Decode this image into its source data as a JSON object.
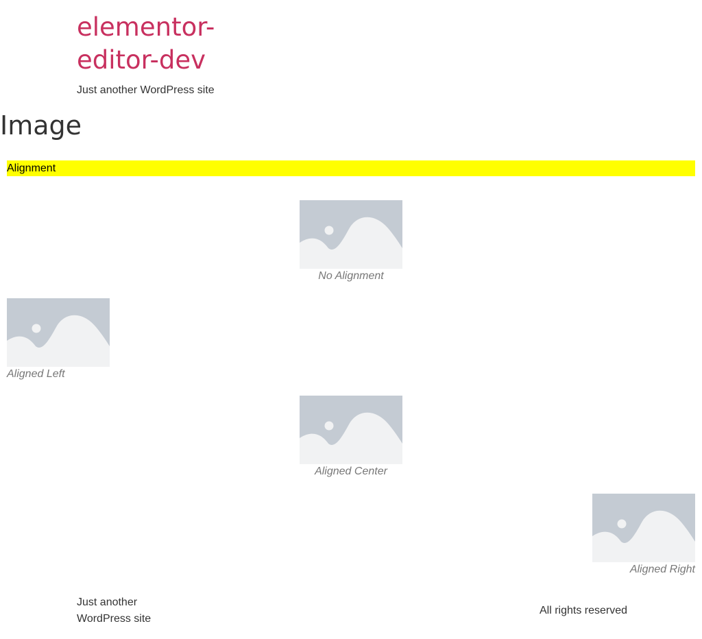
{
  "header": {
    "site_title": "elementor-editor-dev",
    "site_description": "Just another WordPress site"
  },
  "main": {
    "page_title": "Image",
    "section_heading": "Alignment",
    "figures": [
      {
        "caption": "No Alignment",
        "alignment": "none"
      },
      {
        "caption": "Aligned Left",
        "alignment": "left"
      },
      {
        "caption": "Aligned Center",
        "alignment": "center"
      },
      {
        "caption": "Aligned Right",
        "alignment": "right"
      }
    ]
  },
  "footer": {
    "description": "Just another WordPress site",
    "copyright": "All rights reserved"
  },
  "colors": {
    "site_title": "#c8305f",
    "highlight": "#ffff00",
    "placeholder_bg": "#c4cbd3",
    "placeholder_fg": "#f1f2f3",
    "caption": "#777777"
  },
  "icons": {
    "placeholder": "image-placeholder-icon"
  }
}
